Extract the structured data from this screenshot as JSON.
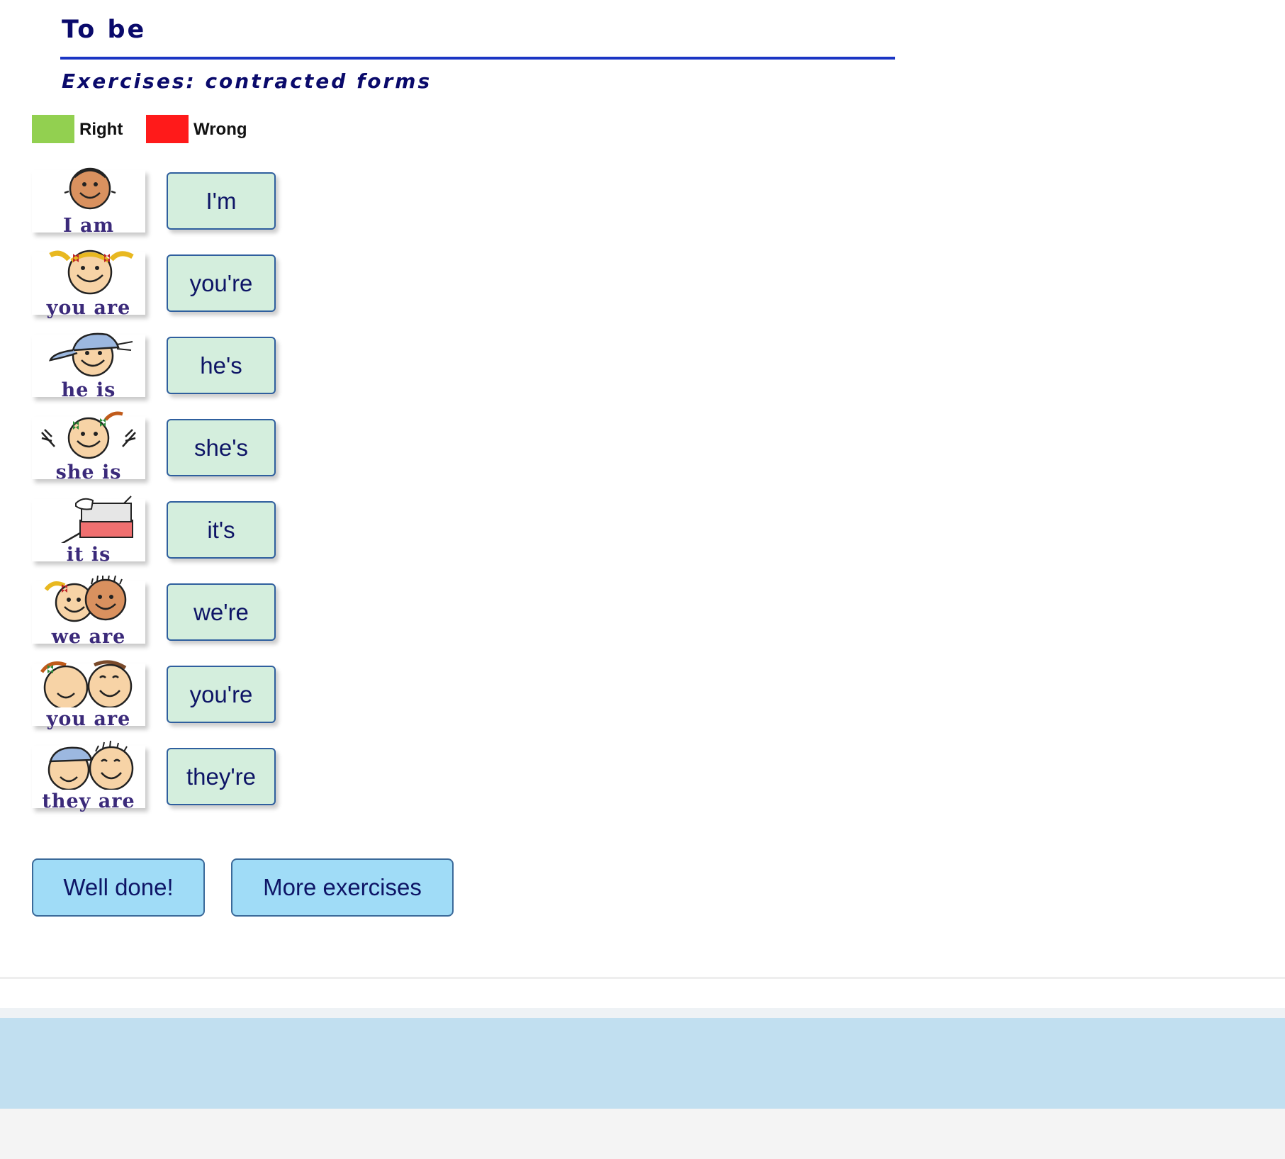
{
  "header": {
    "title": "To be"
  },
  "subtitle": "Exercises: contracted forms",
  "legend": [
    {
      "label": "Right",
      "color": "#92d050"
    },
    {
      "label": "Wrong",
      "color": "#ff1a1a"
    }
  ],
  "exercises": [
    {
      "caption": "I am",
      "picture": "boy-face-icon",
      "answer": "I'm"
    },
    {
      "caption": "you are",
      "picture": "girl-face-icon",
      "answer": "you're"
    },
    {
      "caption": "he is",
      "picture": "boy-with-cap-icon",
      "answer": "he's"
    },
    {
      "caption": "she is",
      "picture": "girl-waving-icon",
      "answer": "she's"
    },
    {
      "caption": "it is",
      "picture": "dog-in-wagon-icon",
      "answer": "it's"
    },
    {
      "caption": "we are",
      "picture": "two-children-icon",
      "answer": "we're"
    },
    {
      "caption": "you are",
      "picture": "two-girls-icon",
      "answer": "you're"
    },
    {
      "caption": "they are",
      "picture": "two-kids-icon",
      "answer": "they're"
    }
  ],
  "buttons": {
    "check_label": "Well done!",
    "more_label": "More exercises"
  }
}
